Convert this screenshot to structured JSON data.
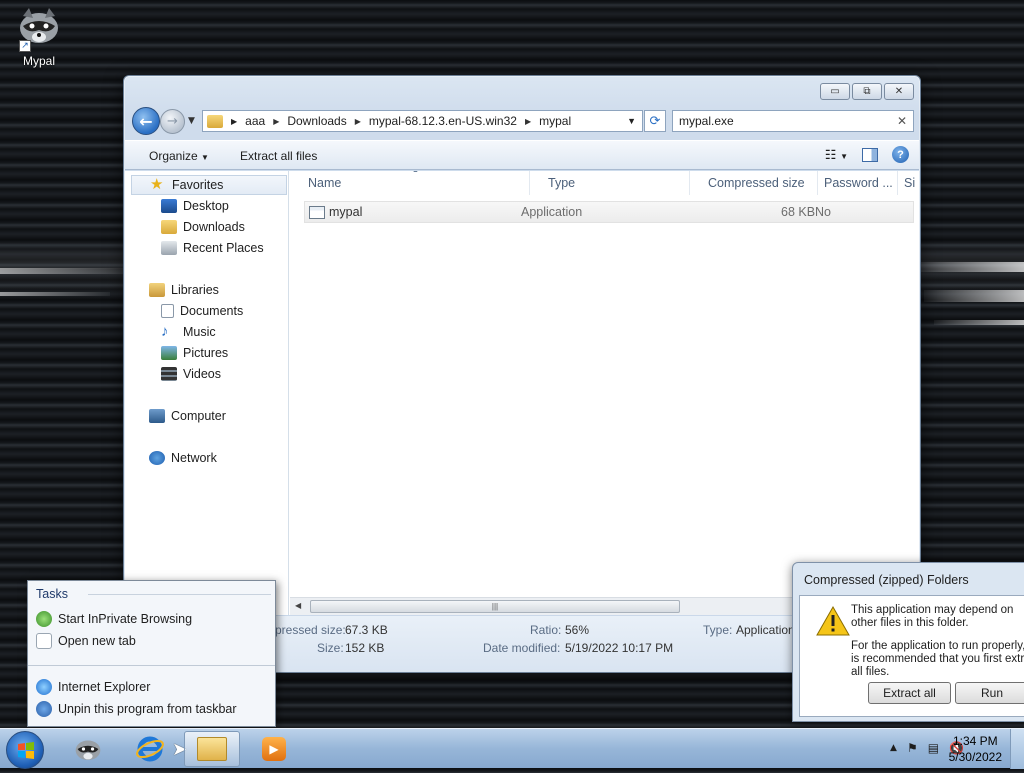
{
  "desktop": {
    "icon_label": "Mypal"
  },
  "window": {
    "caption": {
      "minimize": "▭",
      "maximize": "⧉",
      "close": "✕"
    },
    "address": {
      "crumbs": [
        "aaa",
        "Downloads",
        "mypal-68.12.3.en-US.win32",
        "mypal"
      ]
    },
    "search": {
      "value": "mypal.exe"
    },
    "toolbar": {
      "organize": "Organize",
      "extract_all": "Extract all files"
    },
    "nav": {
      "favorites": "Favorites",
      "desktop": "Desktop",
      "downloads": "Downloads",
      "recent": "Recent Places",
      "libraries": "Libraries",
      "documents": "Documents",
      "music": "Music",
      "pictures": "Pictures",
      "videos": "Videos",
      "computer": "Computer",
      "network": "Network"
    },
    "columns": {
      "name": "Name",
      "type": "Type",
      "compressed_size": "Compressed size",
      "password": "Password ...",
      "size": "Si"
    },
    "files": [
      {
        "name": "mypal",
        "type": "Application",
        "compressed_size": "68 KB",
        "password": "No"
      }
    ],
    "details": {
      "compressed_size_label": "pressed size:",
      "compressed_size_value": "67.3 KB",
      "size_label": "Size:",
      "size_value": "152 KB",
      "ratio_label": "Ratio:",
      "ratio_value": "56%",
      "date_label": "Date modified:",
      "date_value": "5/19/2022 10:17 PM",
      "type_label": "Type:",
      "type_value": "Application"
    }
  },
  "jumplist": {
    "header": "Tasks",
    "tasks": [
      "Start InPrivate Browsing",
      "Open new tab"
    ],
    "app": "Internet Explorer",
    "unpin": "Unpin this program from taskbar"
  },
  "dialog": {
    "title": "Compressed (zipped) Folders",
    "message1": "This application may depend on other files in this folder.",
    "message2": "For the application to run properly, it is recommended that you first extract all files.",
    "extract_all": "Extract all",
    "run": "Run"
  },
  "taskbar": {
    "time": "1:34 PM",
    "date": "5/30/2022"
  }
}
